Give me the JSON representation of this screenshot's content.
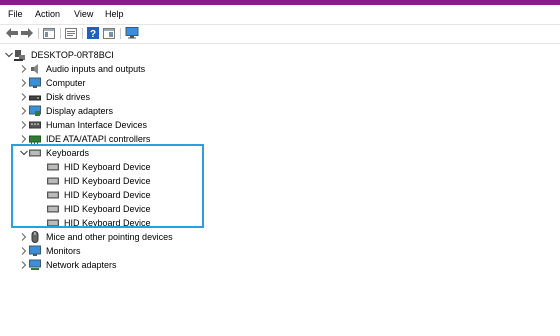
{
  "menu": {
    "file": "File",
    "action": "Action",
    "view": "View",
    "help": "Help"
  },
  "tree": {
    "root": "DESKTOP-0RT8BCI",
    "categories": [
      {
        "label": "Audio inputs and outputs",
        "icon": "speaker-icon"
      },
      {
        "label": "Computer",
        "icon": "monitor-icon"
      },
      {
        "label": "Disk drives",
        "icon": "disk-drive-icon"
      },
      {
        "label": "Display adapters",
        "icon": "display-adapter-icon"
      },
      {
        "label": "Human Interface Devices",
        "icon": "hid-icon"
      },
      {
        "label": "IDE ATA/ATAPI controllers",
        "icon": "ide-controller-icon"
      },
      {
        "label": "Keyboards",
        "icon": "keyboard-icon"
      },
      {
        "label": "Mice and other pointing devices",
        "icon": "mouse-icon"
      },
      {
        "label": "Monitors",
        "icon": "monitor-icon"
      },
      {
        "label": "Network adapters",
        "icon": "network-adapter-icon"
      }
    ],
    "keyboard_children": [
      "HID Keyboard Device",
      "HID Keyboard Device",
      "HID Keyboard Device",
      "HID Keyboard Device",
      "HID Keyboard Device"
    ]
  },
  "colors": {
    "title_bar": "#8b1b8b",
    "highlight_border": "#2a9fdc"
  }
}
